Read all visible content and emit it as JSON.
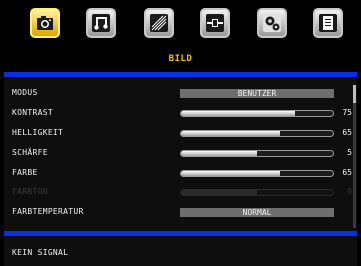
{
  "tabs": [
    {
      "name": "camera-icon",
      "active": true
    },
    {
      "name": "music-note-icon",
      "active": false
    },
    {
      "name": "rf-signal-icon",
      "active": false
    },
    {
      "name": "connector-icon",
      "active": false
    },
    {
      "name": "gears-icon",
      "active": false
    },
    {
      "name": "document-icon",
      "active": false
    }
  ],
  "section_title": "BILD",
  "menu": {
    "modus": {
      "label": "MODUS",
      "value": "BENUTZER"
    },
    "kontrast": {
      "label": "KONTRAST",
      "value": "75",
      "level": 0.75
    },
    "helligkeit": {
      "label": "HELLIGKEIT",
      "value": "65",
      "level": 0.65
    },
    "schaerfe": {
      "label": "SCHÄRFE",
      "value": "5",
      "level": 0.5
    },
    "farbe": {
      "label": "FARBE",
      "value": "65",
      "level": 0.65
    },
    "farbton": {
      "label": "FARBTON",
      "value": "0",
      "level": 0.5,
      "disabled": true
    },
    "farbtemperatur": {
      "label": "FARBTEMPERATUR",
      "value": "NORMAL"
    }
  },
  "status": "KEIN SIGNAL",
  "colors": {
    "accent_yellow": "#e8c400",
    "blue_bar": "#0a2fe0"
  }
}
